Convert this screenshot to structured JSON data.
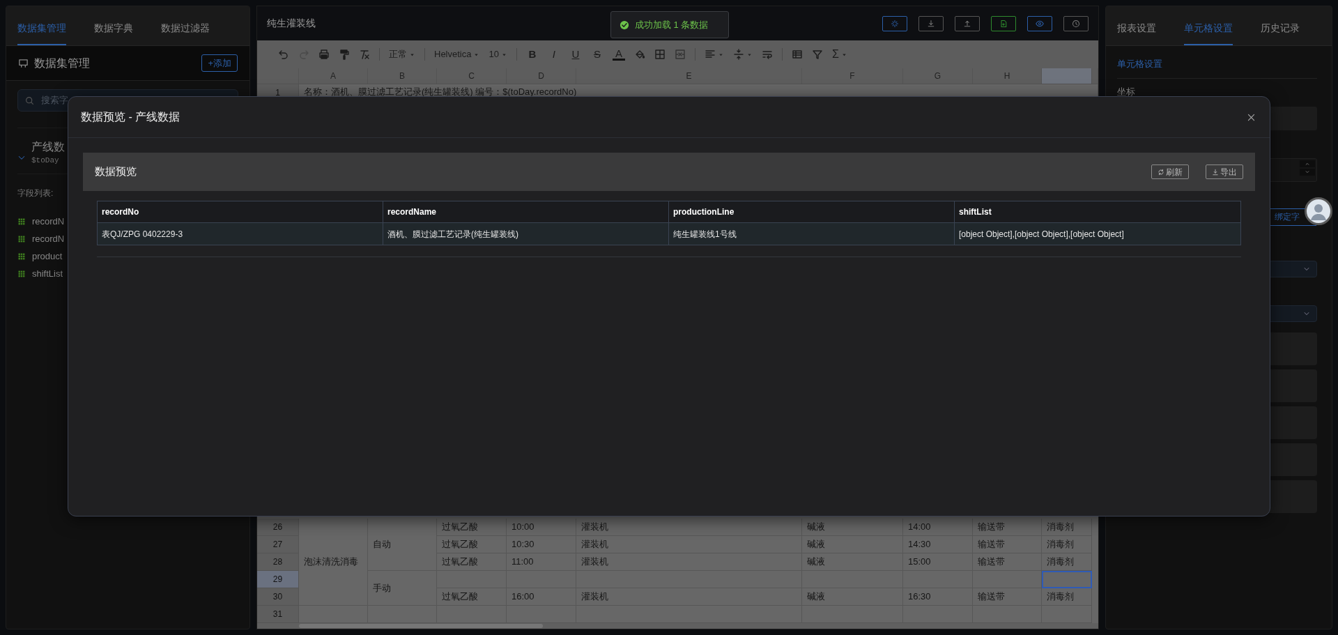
{
  "left_panel": {
    "tabs": [
      {
        "label": "数据集管理",
        "selected": true
      },
      {
        "label": "数据字典",
        "selected": false
      },
      {
        "label": "数据过滤器",
        "selected": false
      }
    ],
    "title": "数据集管理",
    "add_button": "+添加",
    "search": {
      "placeholder": "搜索字"
    },
    "datasets": [
      {
        "name": "产线数",
        "variable": "$toDay",
        "expanded": true
      }
    ],
    "fields_label": "字段列表:",
    "fields": [
      "recordN",
      "recordN",
      "product",
      "shiftList"
    ]
  },
  "editor": {
    "title": "纯生灌装线",
    "history": {
      "undo_enabled": true,
      "redo_enabled": false
    },
    "selects": [
      "正常",
      "Helvetica",
      "10"
    ],
    "format_buttons": [
      {
        "label": "B",
        "kind": "bold"
      },
      {
        "label": "I",
        "kind": "italic"
      },
      {
        "label": "U",
        "kind": "underline"
      },
      {
        "label": "S",
        "kind": "strike"
      },
      {
        "label": "A",
        "kind": "color"
      }
    ],
    "function_button": "Σ",
    "columns": [
      {
        "label": "A",
        "selected": false
      },
      {
        "label": "B",
        "selected": false
      },
      {
        "label": "C",
        "selected": false
      },
      {
        "label": "D",
        "selected": false
      },
      {
        "label": "E",
        "selected": false
      },
      {
        "label": "F",
        "selected": false
      },
      {
        "label": "G",
        "selected": false
      },
      {
        "label": "H",
        "selected": false
      },
      {
        "selected": true
      }
    ],
    "first_row": {
      "number": "1",
      "text": "名称：酒机、膜过滤工艺记录(纯生罐装线) 编号：$(toDay.recordNo)"
    },
    "groups": [
      {
        "label": "泡沫清洗消毒",
        "modes": [
          {
            "label": "自动",
            "rows": [
              {
                "number": "26",
                "selected": false,
                "cells": [
                  "过氧乙酸",
                  "10:00",
                  "灌装机",
                  "碱液",
                  "14:00",
                  "输送带",
                  "消毒剂"
                ]
              },
              {
                "number": "27",
                "selected": false,
                "cells": [
                  "过氧乙酸",
                  "10:30",
                  "灌装机",
                  "碱液",
                  "14:30",
                  "输送带",
                  "消毒剂"
                ]
              },
              {
                "number": "28",
                "selected": false,
                "cells": [
                  "过氧乙酸",
                  "11:00",
                  "灌装机",
                  "碱液",
                  "15:00",
                  "输送带",
                  "消毒剂"
                ]
              }
            ]
          },
          {
            "label": "手动",
            "rows": [
              {
                "number": "29",
                "selected": true
              },
              {
                "number": "30",
                "selected": false,
                "cells": [
                  "过氧乙酸",
                  "16:00",
                  "灌装机",
                  "碱液",
                  "16:30",
                  "输送带",
                  "消毒剂"
                ]
              }
            ]
          }
        ]
      },
      {
        "modes": [
          {
            "rows": [
              {
                "number": "31",
                "selected": false
              }
            ]
          }
        ]
      }
    ]
  },
  "toast": "成功加载 1 条数据",
  "right_panel": {
    "tabs": [
      {
        "label": "报表设置",
        "selected": false
      },
      {
        "label": "单元格设置",
        "selected": true
      },
      {
        "label": "历史记录",
        "selected": false
      }
    ],
    "section_title": "单元格设置",
    "coordinate_label": "坐标",
    "bind_button": "绑定字"
  },
  "modal": {
    "title": "数据预览 - 产线数据",
    "card_title": "数据预览",
    "actions": [
      {
        "label": "刷新",
        "kind": "refresh"
      },
      {
        "label": "导出",
        "kind": "export"
      }
    ],
    "table": {
      "columns": [
        "recordNo",
        "recordName",
        "productionLine",
        "shiftList"
      ],
      "rows": [
        [
          "表QJ/ZPG 0402229-3",
          "酒机、膜过滤工艺记录(纯生罐装线)",
          "纯生罐装线1号线",
          "[object Object],[object Object],[object Object]"
        ]
      ]
    }
  }
}
